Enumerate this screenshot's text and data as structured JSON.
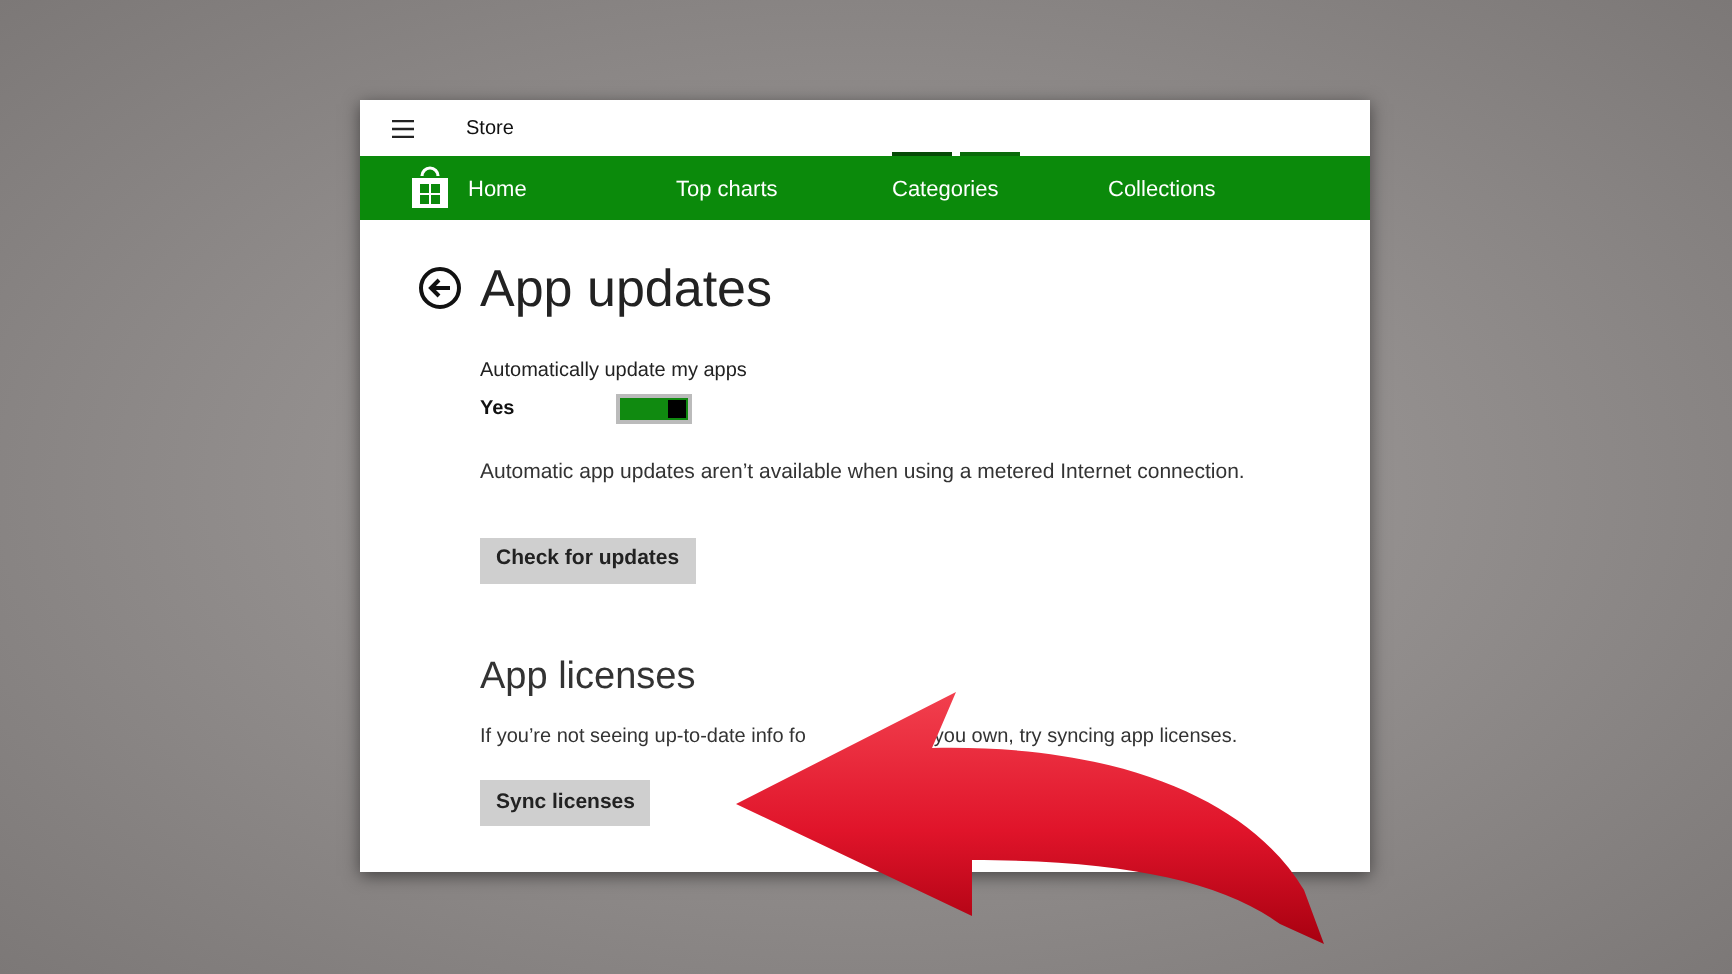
{
  "window": {
    "title": "Store"
  },
  "nav": {
    "items": [
      {
        "label": "Home"
      },
      {
        "label": "Top charts"
      },
      {
        "label": "Categories",
        "loading": true
      },
      {
        "label": "Collections"
      }
    ]
  },
  "page": {
    "title": "App updates"
  },
  "auto_update": {
    "label": "Automatically update my apps",
    "value": "Yes",
    "on": true
  },
  "note": "Automatic app updates aren’t available when using a metered Internet connection.",
  "check_button": "Check for updates",
  "licenses": {
    "heading": "App licenses",
    "text_before": "If you’re not seeing up-to-date info fo",
    "text_after": "you own, try syncing app licenses.",
    "button": "Sync licenses"
  }
}
